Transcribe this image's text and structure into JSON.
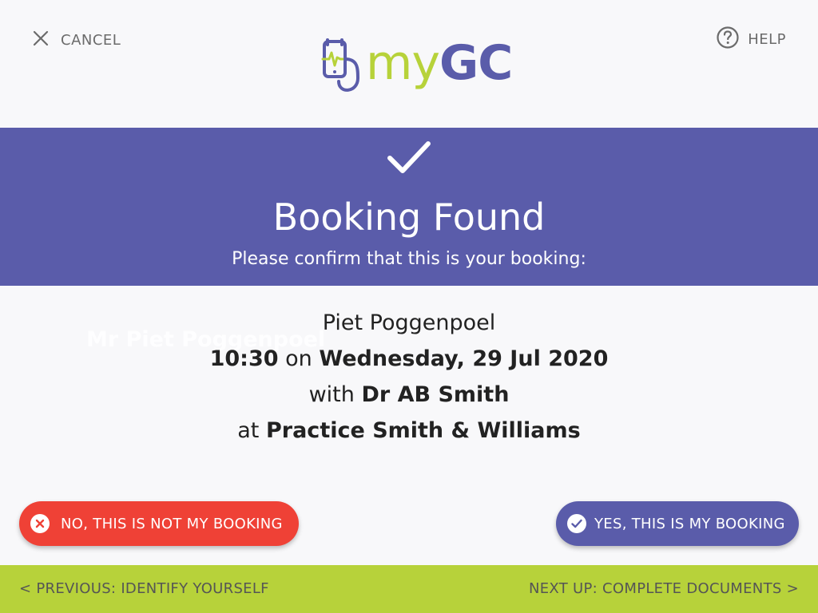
{
  "header": {
    "cancel_label": "CANCEL",
    "help_label": "HELP",
    "logo": {
      "my": "my",
      "gc": "GC"
    }
  },
  "banner": {
    "title": "Booking Found",
    "subtitle": "Please confirm that this is your booking:"
  },
  "booking": {
    "ghost_name": "Mr Piet Poggenpoel",
    "patient_name": "Piet Poggenpoel",
    "time": "10:30",
    "on_word": "on",
    "date": "Wednesday, 29 Jul 2020",
    "with_word": "with",
    "doctor": "Dr AB Smith",
    "at_word": "at",
    "practice": "Practice Smith & Williams"
  },
  "actions": {
    "reject_label": "NO, THIS IS NOT MY BOOKING",
    "confirm_label": "YES, THIS IS MY BOOKING"
  },
  "footer": {
    "previous_label": "< PREVIOUS: IDENTIFY YOURSELF",
    "next_label": "NEXT UP: COMPLETE DOCUMENTS >"
  },
  "colors": {
    "primary": "#5a5caa",
    "accent": "#b7d23a",
    "danger": "#ef4136",
    "background": "#f8f8fa"
  },
  "icons": {
    "cancel": "close-icon",
    "help": "help-icon",
    "banner": "checkmark-icon",
    "reject": "close-circle-icon",
    "confirm": "check-circle-icon",
    "logo": "stethoscope-phone-icon"
  }
}
